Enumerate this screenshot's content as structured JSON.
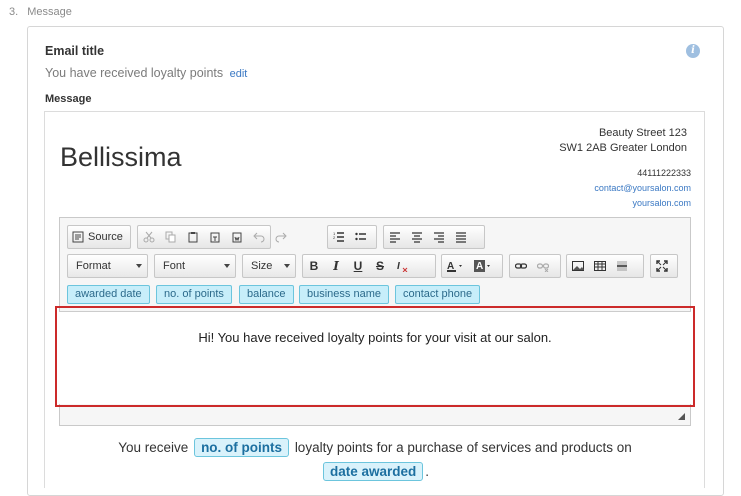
{
  "step": {
    "number": "3.",
    "label": "Message"
  },
  "email_title": {
    "label": "Email title",
    "value": "You have received loyalty points",
    "edit_label": "edit"
  },
  "message_label": "Message",
  "salon": {
    "name": "Bellissima",
    "address_line1": "Beauty Street 123",
    "address_line2": "SW1 2AB Greater London",
    "phone": "44111222333",
    "email": "contact@yoursalon.com",
    "website": "yoursalon.com"
  },
  "toolbar": {
    "source_label": "Source",
    "format_label": "Format",
    "font_label": "Font",
    "size_label": "Size",
    "bold_label": "B",
    "italic_label": "I",
    "underline_label": "U",
    "strike_label": "S"
  },
  "tags": [
    "awarded date",
    "no. of points",
    "balance",
    "business name",
    "contact phone"
  ],
  "editor_content": "Hi! You have received loyalty points for your visit at our salon.",
  "preview": {
    "prefix": "You receive",
    "tag1": "no. of points",
    "middle": "loyalty points for a purchase of services and products on",
    "tag2": "date awarded",
    "suffix": "."
  }
}
